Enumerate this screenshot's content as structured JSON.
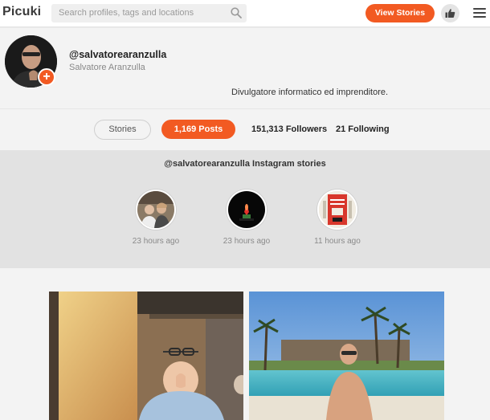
{
  "header": {
    "logo": "Picuki",
    "search_placeholder": "Search profiles, tags and locations",
    "view_stories_label": "View Stories",
    "icons": [
      "search-icon",
      "thumbs-up-icon",
      "hamburger-menu-icon"
    ]
  },
  "profile": {
    "username": "@salvatorearanzulla",
    "full_name": "Salvatore Aranzulla",
    "bio": "Divulgatore informatico ed imprenditore."
  },
  "stats": {
    "stories_label": "Stories",
    "posts_label": "1,169 Posts",
    "followers_label": "151,313 Followers",
    "following_label": "21 Following"
  },
  "stories": {
    "title": "@salvatorearanzulla Instagram stories",
    "items": [
      {
        "time": "23 hours ago"
      },
      {
        "time": "23 hours ago"
      },
      {
        "time": "11 hours ago"
      }
    ]
  },
  "colors": {
    "accent": "#f25a22"
  }
}
